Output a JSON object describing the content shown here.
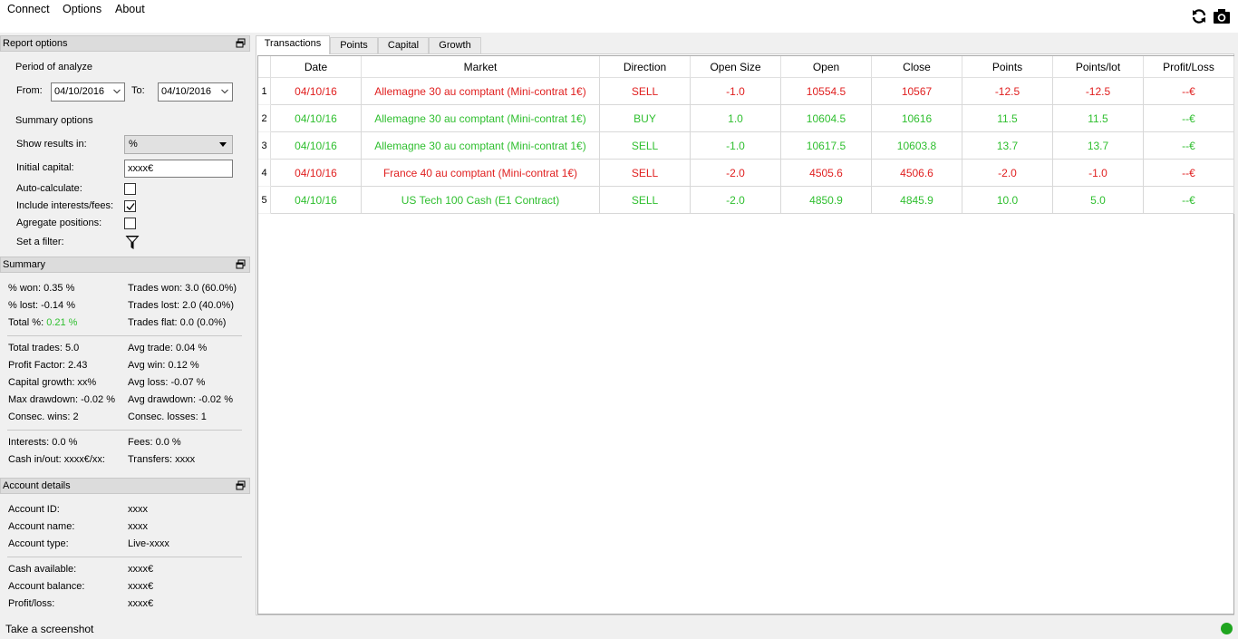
{
  "menubar": {
    "items": [
      "Connect",
      "Options",
      "About"
    ]
  },
  "toolbar": {
    "refresh_icon": "refresh-icon",
    "screenshot_icon": "camera-icon"
  },
  "report_options": {
    "title": "Report options",
    "period_label": "Period of analyze",
    "from_label": "From:",
    "from_value": "04/10/2016",
    "to_label": "To:",
    "to_value": "04/10/2016",
    "summary_options_label": "Summary options",
    "show_results_label": "Show results in:",
    "show_results_value": "%",
    "initial_capital_label": "Initial capital:",
    "initial_capital_value": "xxxx€",
    "auto_calc_label": "Auto-calculate:",
    "auto_calc_checked": false,
    "include_fees_label": "Include interests/fees:",
    "include_fees_checked": true,
    "aggregate_label": "Agregate positions:",
    "aggregate_checked": false,
    "filter_label": "Set a filter:"
  },
  "summary": {
    "title": "Summary",
    "won_pct": "% won: 0.35 %",
    "trades_won": "Trades won: 3.0 (60.0%)",
    "lost_pct": "% lost: -0.14 %",
    "trades_lost": "Trades lost: 2.0 (40.0%)",
    "total_pct_label": "Total %:",
    "total_pct_value": "0.21 %",
    "trades_flat": "Trades flat: 0.0 (0.0%)",
    "total_trades": "Total trades: 5.0",
    "avg_trade": "Avg trade: 0.04 %",
    "profit_factor": "Profit Factor: 2.43",
    "avg_win": "Avg win: 0.12 %",
    "capital_growth": "Capital growth: xx%",
    "avg_loss": "Avg loss: -0.07 %",
    "max_drawdown": "Max drawdown: -0.02 %",
    "avg_drawdown": "Avg drawdown: -0.02 %",
    "consec_wins": "Consec. wins: 2",
    "consec_losses": "Consec. losses: 1",
    "interests": "Interests: 0.0 %",
    "fees": "Fees: 0.0 %",
    "cash_inout": "Cash in/out: xxxx€/xx:",
    "transfers": "Transfers: xxxx"
  },
  "account": {
    "title": "Account details",
    "id_label": "Account ID:",
    "id_value": "xxxx",
    "name_label": "Account name:",
    "name_value": "xxxx",
    "type_label": "Account type:",
    "type_value": "Live-xxxx",
    "cash_label": "Cash available:",
    "cash_value": "xxxx€",
    "balance_label": "Account balance:",
    "balance_value": "xxxx€",
    "pl_label": "Profit/loss:",
    "pl_value": "xxxx€"
  },
  "tabs": [
    "Transactions",
    "Points",
    "Capital",
    "Growth"
  ],
  "table": {
    "columns": [
      "Date",
      "Market",
      "Direction",
      "Open Size",
      "Open",
      "Close",
      "Points",
      "Points/lot",
      "Profit/Loss"
    ],
    "rows": [
      {
        "n": "1",
        "result": "loss",
        "cells": [
          "04/10/16",
          "Allemagne 30 au comptant (Mini-contrat 1€)",
          "SELL",
          "-1.0",
          "10554.5",
          "10567",
          "-12.5",
          "-12.5",
          "--€"
        ]
      },
      {
        "n": "2",
        "result": "win",
        "cells": [
          "04/10/16",
          "Allemagne 30 au comptant (Mini-contrat 1€)",
          "BUY",
          "1.0",
          "10604.5",
          "10616",
          "11.5",
          "11.5",
          "--€"
        ]
      },
      {
        "n": "3",
        "result": "win",
        "cells": [
          "04/10/16",
          "Allemagne 30 au comptant (Mini-contrat 1€)",
          "SELL",
          "-1.0",
          "10617.5",
          "10603.8",
          "13.7",
          "13.7",
          "--€"
        ]
      },
      {
        "n": "4",
        "result": "loss",
        "cells": [
          "04/10/16",
          "France 40 au comptant (Mini-contrat 1€)",
          "SELL",
          "-2.0",
          "4505.6",
          "4506.6",
          "-2.0",
          "-1.0",
          "--€"
        ]
      },
      {
        "n": "5",
        "result": "win",
        "cells": [
          "04/10/16",
          "US Tech 100 Cash (E1 Contract)",
          "SELL",
          "-2.0",
          "4850.9",
          "4845.9",
          "10.0",
          "5.0",
          "--€"
        ]
      }
    ]
  },
  "colors": {
    "win": "#2fbf2f",
    "loss": "#e02020",
    "status_ok": "#1fa51f"
  },
  "statusbar": {
    "message": "Take a screenshot"
  }
}
